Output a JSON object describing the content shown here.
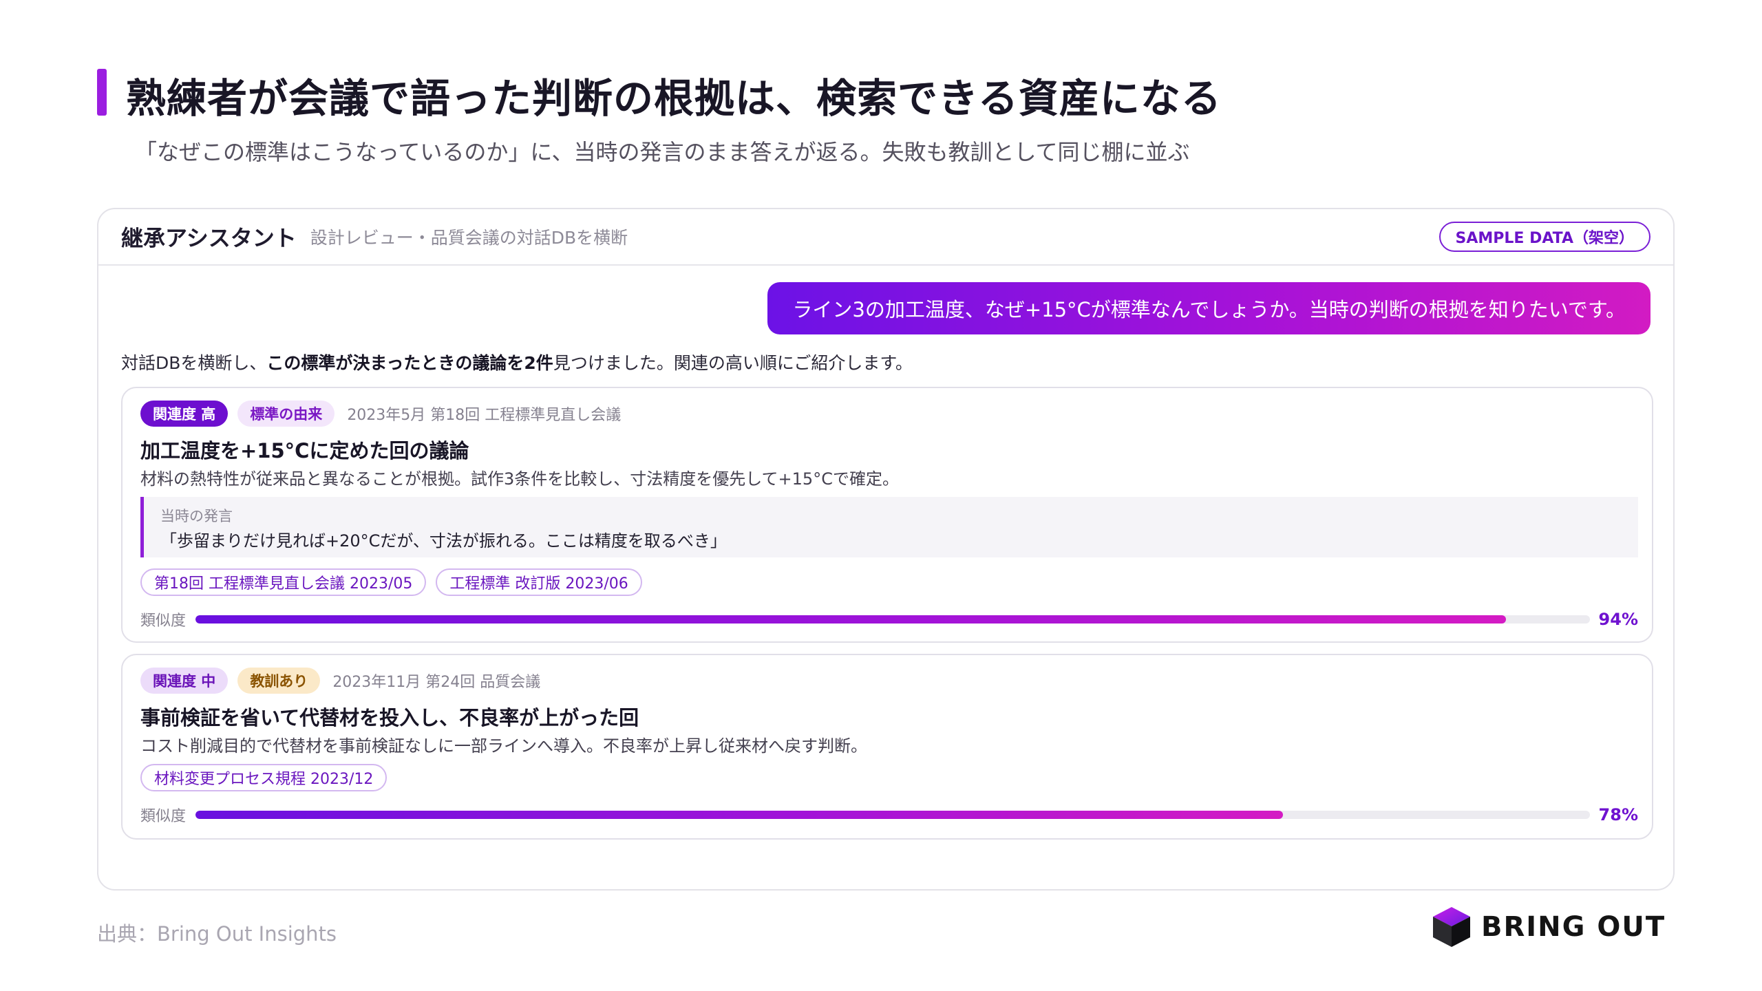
{
  "heading": {
    "title": "熟練者が会議で語った判断の根拠は、検索できる資産になる",
    "subtitle": "「なぜこの標準はこうなっているのか」に、当時の発言のまま答えが返る。失敗も教訓として同じ棚に並ぶ"
  },
  "panel": {
    "title": "継承アシスタント",
    "subtitle": "設計レビュー・品質会議の対話DBを横断",
    "badge": "SAMPLE DATA（架空）"
  },
  "user_message": "ライン3の加工温度、なぜ+15°Cが標準なんでしょうか。当時の判断の根拠を知りたいです。",
  "answer": {
    "prefix": "対話DBを横断し、",
    "emphasis": "この標準が決まったときの議論を2件",
    "suffix": "見つけました。関連の高い順にご紹介します。"
  },
  "results": [
    {
      "relevance_tag": "関連度 高",
      "category_tag": "標準の由来",
      "meeting": "2023年5月 第18回 工程標準見直し会議",
      "title": "加工温度を+15°Cに定めた回の議論",
      "description": "材料の熱特性が従来品と異なることが根拠。試作3条件を比較し、寸法精度を優先して+15°Cで確定。",
      "quote_label": "当時の発言",
      "quote": "「歩留まりだけ見れば+20°Cだが、寸法が振れる。ここは精度を取るべき」",
      "refs": [
        "第18回 工程標準見直し会議 2023/05",
        "工程標準 改訂版 2023/06"
      ],
      "similarity_label": "類似度",
      "similarity": 0.94,
      "similarity_text": "94%"
    },
    {
      "relevance_tag": "関連度 中",
      "category_tag": "教訓あり",
      "meeting": "2023年11月 第24回 品質会議",
      "title": "事前検証を省いて代替材を投入し、不良率が上がった回",
      "description": "コスト削減目的で代替材を事前検証なしに一部ラインへ導入。不良率が上昇し従来材へ戻す判断。",
      "refs": [
        "材料変更プロセス規程 2023/12"
      ],
      "similarity_label": "類似度",
      "similarity": 0.78,
      "similarity_text": "78%"
    }
  ],
  "footer": {
    "source": "出典：Bring Out Insights",
    "logo_text": "BRING OUT"
  },
  "colors": {
    "accent": "#9b1ee0",
    "gradient_start": "#6c12e6",
    "gradient_end": "#d21bc3"
  }
}
